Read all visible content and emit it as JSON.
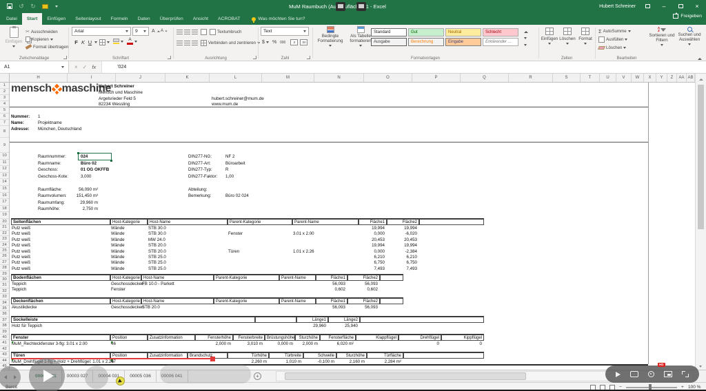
{
  "titlebar": {
    "title": "MuM Raumbuch (Ausbauflächen)1 - Excel",
    "user": "Hubert Schreiner",
    "share": "Freigeben",
    "tell_me": "Was möchten Sie tun?"
  },
  "ribbon_tabs": [
    {
      "label": "Datei",
      "active": false
    },
    {
      "label": "Start",
      "active": true
    },
    {
      "label": "Einfügen",
      "active": false
    },
    {
      "label": "Seitenlayout",
      "active": false
    },
    {
      "label": "Formeln",
      "active": false
    },
    {
      "label": "Daten",
      "active": false
    },
    {
      "label": "Überprüfen",
      "active": false
    },
    {
      "label": "Ansicht",
      "active": false
    },
    {
      "label": "ACROBAT",
      "active": false
    }
  ],
  "ribbon": {
    "clipboard": {
      "paste": "Einfügen",
      "cut": "Ausschneiden",
      "copy": "Kopieren",
      "painter": "Format übertragen",
      "group": "Zwischenablage"
    },
    "font": {
      "family": "Arial",
      "size": "9",
      "bold": "F",
      "italic": "K",
      "underline": "U",
      "group": "Schriftart"
    },
    "alignment": {
      "wrap": "Textumbruch",
      "merge": "Verbinden und zentrieren",
      "group": "Ausrichtung"
    },
    "number": {
      "format": "Text",
      "currency": "$",
      "percent": "%",
      "thousands": "000",
      "dec1": ".0",
      "dec2": ".00",
      "group": "Zahl"
    },
    "styles": {
      "conditional": "Bedingte Formatierung",
      "as_table": "Als Tabelle formatieren",
      "group": "Formatvorlagen",
      "gallery": [
        "Standard",
        "Gut",
        "Neutral",
        "Schlecht",
        "Ausgabe",
        "Berechnung",
        "Eingabe",
        "Erklärender ..."
      ]
    },
    "cells": {
      "insert": "Einfügen",
      "delete": "Löschen",
      "format": "Format",
      "group": "Zellen"
    },
    "editing": {
      "autosum": "AutoSumme",
      "fill": "Ausfüllen",
      "clear": "Löschen",
      "sort": "Sortieren und Filtern",
      "find": "Suchen und Auswählen",
      "group": "Bearbeiten"
    }
  },
  "formula_bar": {
    "name_box": "A1",
    "fx": "fx",
    "value": "'024"
  },
  "grid": {
    "columns": [
      "H",
      "I",
      "J",
      "K",
      "L",
      "M",
      "N",
      "O",
      "P",
      "Q",
      "R",
      "S",
      "T",
      "U",
      "V",
      "W",
      "X",
      "Y",
      "Z",
      "AA",
      "AB"
    ],
    "row_count": 45
  },
  "sheet": {
    "logo": {
      "part1": "mensch",
      "mark": "x-mark",
      "part2": "maschine"
    },
    "contact_left": [
      "Hubert Schreiner",
      "Mensch und Maschine",
      "Argelsrieder Feld 5",
      "82234 Wessling"
    ],
    "contact_right": [
      "hubert.schreiner@mum.de",
      "www.mum.de"
    ],
    "project": [
      {
        "label": "Nummer:",
        "value": "1"
      },
      {
        "label": "Name:",
        "value": "Projektname"
      },
      {
        "label": "Adresse:",
        "value": "München, Deutschland"
      }
    ],
    "room_info": [
      {
        "label": "Raumnummer:",
        "value": "024",
        "bold": true,
        "selected": true
      },
      {
        "label": "Raumname:",
        "value": "Büro 02",
        "bold": true
      },
      {
        "label": "Geschoss:",
        "value": "01 OG OKFFB",
        "bold": true
      },
      {
        "label": "Geschoss-Kote:",
        "value": "3,000"
      }
    ],
    "room_metrics": [
      {
        "label": "Raumfläche:",
        "value": "56,090 m²"
      },
      {
        "label": "Raumvolumen:",
        "value": "151,450 m³"
      },
      {
        "label": "Raumumfang:",
        "value": "29,960 m"
      },
      {
        "label": "Raumhöhe:",
        "value": "2,750 m"
      }
    ],
    "din_info": [
      {
        "label": "DIN277-NG:",
        "value": "NF 2"
      },
      {
        "label": "DIN277-Art:",
        "value": "Büroarbeit"
      },
      {
        "label": "DIN277-Typ:",
        "value": "R"
      },
      {
        "label": "DIN277-Faktor:",
        "value": "1,00"
      }
    ],
    "misc_info": [
      {
        "label": "Abteilung:",
        "value": ""
      },
      {
        "label": "Bemerkung:",
        "value": "Büro 02 024"
      }
    ],
    "sections": {
      "seiten": {
        "title": "Seitenflächen",
        "headers": [
          "Host-Kategorie",
          "Host-Name",
          "Parent-Kategorie",
          "Parent-Name",
          "Fläche1",
          "Fläche2"
        ],
        "rows": [
          [
            "Putz weiß",
            "Wände",
            "STB 30.0",
            "",
            "",
            "19,994",
            "19,994"
          ],
          [
            "Putz weiß",
            "Wände",
            "STB 30.0",
            "Fenster",
            "3.01 x 2.00",
            "0,000",
            "-6,020"
          ],
          [
            "Putz weiß",
            "Wände",
            "MW 24.0",
            "",
            "",
            "20,453",
            "20,453"
          ],
          [
            "Putz weiß",
            "Wände",
            "STB 20.0",
            "",
            "",
            "19,994",
            "19,994"
          ],
          [
            "Putz weiß",
            "Wände",
            "STB 20.0",
            "Türen",
            "1.01 x 2.26",
            "0,000",
            "-2,384"
          ],
          [
            "Putz weiß",
            "Wände",
            "STB 25.0",
            "",
            "",
            "6,210",
            "6,210"
          ],
          [
            "Putz weiß",
            "Wände",
            "STB 25.0",
            "",
            "",
            "6,750",
            "6,750"
          ],
          [
            "Putz weiß",
            "Wände",
            "STB 25.0",
            "",
            "",
            "7,493",
            "7,493"
          ]
        ]
      },
      "boden": {
        "title": "Bodenflächen",
        "headers": [
          "Host-Kategorie",
          "Host-Name",
          "Parent-Kategorie",
          "Parent-Name",
          "Fläche1",
          "Fläche2"
        ],
        "rows": [
          [
            "Teppich",
            "Geschossdecken",
            "FB 10.0 - Parkett",
            "",
            "",
            "56,093",
            "56,093"
          ],
          [
            "Teppich",
            "Fenster",
            "",
            "",
            "",
            "0,602",
            "0,602"
          ]
        ]
      },
      "decken": {
        "title": "Deckenflächen",
        "headers": [
          "Host-Kategorie",
          "Host-Name",
          "Parent-Kategorie",
          "Parent-Name",
          "Fläche1",
          "Fläche2"
        ],
        "rows": [
          [
            "Akustikdecke",
            "Geschossdecken",
            "STB 20.0",
            "",
            "",
            "56,093",
            "56,093"
          ]
        ]
      },
      "sockel": {
        "title": "Sockelleiste",
        "headers": [
          "",
          "Länge1",
          "Länge2"
        ],
        "rows": [
          [
            "Holz für Teppich",
            "",
            "29,960",
            "25,940"
          ]
        ]
      },
      "fenster": {
        "title": "Fenster",
        "headers": [
          "Position",
          "Zusatzinformation",
          "Fensterhöhe",
          "Fensterbreite",
          "Brüstungshöhe",
          "Sturzhöhe",
          "Fensterfläche",
          "Klappflügel",
          "Drehflügel",
          "Kippflügel"
        ],
        "rows": [
          [
            "MuM_Rechteckfenster 3-flg: 3.01 x 2.00",
            "46",
            "",
            "2,000 m",
            "3,010 m",
            "0,000 m",
            "2,000 m",
            "6,020 m²",
            "",
            "0",
            "0"
          ]
        ]
      },
      "tueren": {
        "title": "Türen",
        "headers": [
          "Position",
          "Zusatzinformation",
          "Brandschutz",
          "Türhöhe",
          "Türbreite",
          "Schwelle",
          "Sturzhöhe",
          "Türfläche"
        ],
        "rows": [
          [
            "MuM_Drehflügel 1-flg + Holz + Drehflügel: 1.01 x 2.26",
            "47",
            "",
            "",
            "2,260 m",
            "1,010 m",
            "-0,100 m",
            "2,160 m",
            "2,284 m²"
          ]
        ]
      }
    }
  },
  "sheet_tabs": [
    "00002 021",
    "00003 027",
    "00004 031",
    "00005 036",
    "00006 041"
  ],
  "status": {
    "ready": "Bereit",
    "zoom": "100 %"
  },
  "icons": {
    "undo": "↺",
    "redo": "↻",
    "cut": "✂",
    "autosum": "Σ",
    "new_sheet": "+",
    "close": "×",
    "minimize": "–"
  },
  "colors": {
    "title_green": "#217346",
    "accent_orange": "#ff6a00",
    "selection_green": "#1e7145",
    "annotation_red": "#e03a3a"
  }
}
